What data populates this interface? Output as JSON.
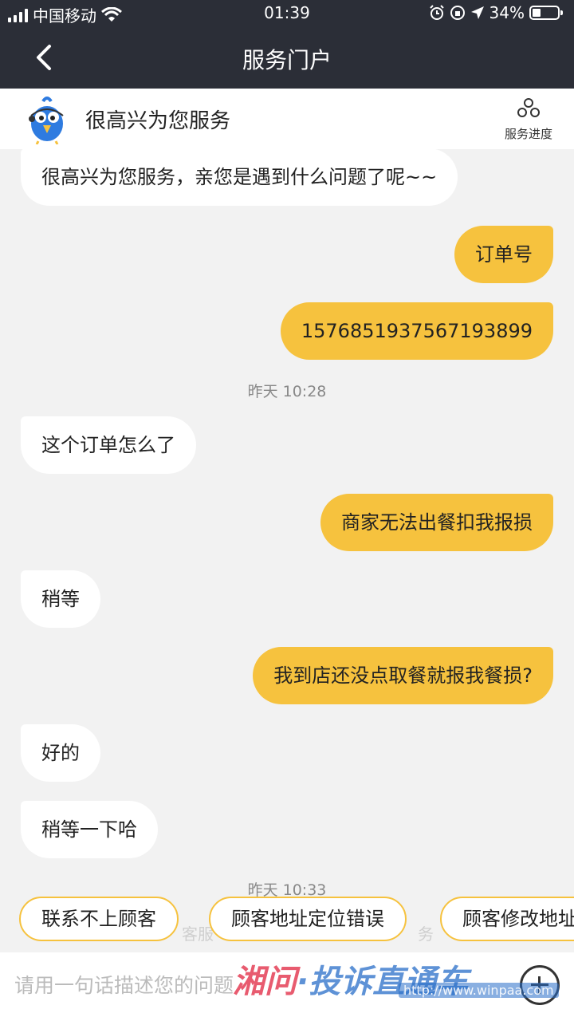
{
  "status": {
    "carrier": "中国移动",
    "time": "01:39",
    "battery": "34%",
    "battery_level": 0.34
  },
  "nav": {
    "title": "服务门户"
  },
  "agent": {
    "name": "很高兴为您服务",
    "progress_label": "服务进度"
  },
  "messages": [
    {
      "from": "agent",
      "text": "很高兴为您服务，亲您是遇到什么问题了呢~~"
    },
    {
      "from": "user",
      "text": "订单号"
    },
    {
      "from": "user",
      "text": "1576851937567193899"
    },
    {
      "from": "time",
      "text": "昨天 10:28"
    },
    {
      "from": "agent",
      "text": "这个订单怎么了"
    },
    {
      "from": "user",
      "text": "商家无法出餐扣我报损"
    },
    {
      "from": "agent",
      "text": "稍等"
    },
    {
      "from": "user",
      "text": "我到店还没点取餐就报我餐损?"
    },
    {
      "from": "agent",
      "text": "好的"
    },
    {
      "from": "agent",
      "text": "稍等一下哈"
    },
    {
      "from": "time",
      "text": "昨天 10:33"
    }
  ],
  "faded_notice": {
    "part1": "客服",
    "part2": "务"
  },
  "quick_replies": [
    "联系不上顾客",
    "顾客地址定位错误",
    "顾客修改地址"
  ],
  "input": {
    "placeholder": "请用一句话描述您的问题"
  },
  "watermark": {
    "text_a": "湘问",
    "text_b": "·投诉直通车",
    "url": "http://www.winpaa.com"
  }
}
